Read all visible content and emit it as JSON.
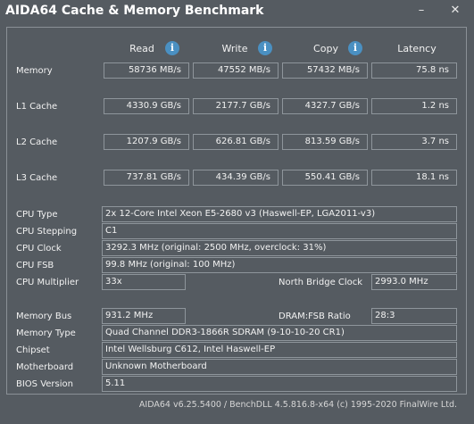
{
  "window": {
    "title": "AIDA64 Cache & Memory Benchmark",
    "minimize_glyph": "–",
    "close_glyph": "✕"
  },
  "columns": {
    "read": "Read",
    "write": "Write",
    "copy": "Copy",
    "latency": "Latency",
    "info_glyph": "i"
  },
  "rows": {
    "memory": {
      "label": "Memory",
      "read": "58736 MB/s",
      "write": "47552 MB/s",
      "copy": "57432 MB/s",
      "latency": "75.8 ns"
    },
    "l1": {
      "label": "L1 Cache",
      "read": "4330.9 GB/s",
      "write": "2177.7 GB/s",
      "copy": "4327.7 GB/s",
      "latency": "1.2 ns"
    },
    "l2": {
      "label": "L2 Cache",
      "read": "1207.9 GB/s",
      "write": "626.81 GB/s",
      "copy": "813.59 GB/s",
      "latency": "3.7 ns"
    },
    "l3": {
      "label": "L3 Cache",
      "read": "737.81 GB/s",
      "write": "434.39 GB/s",
      "copy": "550.41 GB/s",
      "latency": "18.1 ns"
    }
  },
  "cpu": {
    "type_label": "CPU Type",
    "type_value": "2x 12-Core Intel Xeon E5-2680 v3  (Haswell-EP, LGA2011-v3)",
    "stepping_label": "CPU Stepping",
    "stepping_value": "C1",
    "clock_label": "CPU Clock",
    "clock_value": "3292.3 MHz  (original: 2500 MHz, overclock: 31%)",
    "fsb_label": "CPU FSB",
    "fsb_value": "99.8 MHz  (original: 100 MHz)",
    "multiplier_label": "CPU Multiplier",
    "multiplier_value": "33x",
    "nb_clock_label": "North Bridge Clock",
    "nb_clock_value": "2993.0 MHz"
  },
  "memory_info": {
    "bus_label": "Memory Bus",
    "bus_value": "931.2 MHz",
    "ratio_label": "DRAM:FSB Ratio",
    "ratio_value": "28:3",
    "type_label": "Memory Type",
    "type_value": "Quad Channel DDR3-1866R SDRAM  (9-10-10-20 CR1)",
    "chipset_label": "Chipset",
    "chipset_value": "Intel Wellsburg C612, Intel Haswell-EP",
    "motherboard_label": "Motherboard",
    "motherboard_value": "Unknown Motherboard",
    "bios_label": "BIOS Version",
    "bios_value": "5.11"
  },
  "footer": "AIDA64 v6.25.5400 / BenchDLL 4.5.816.8-x64  (c) 1995-2020 FinalWire Ltd."
}
